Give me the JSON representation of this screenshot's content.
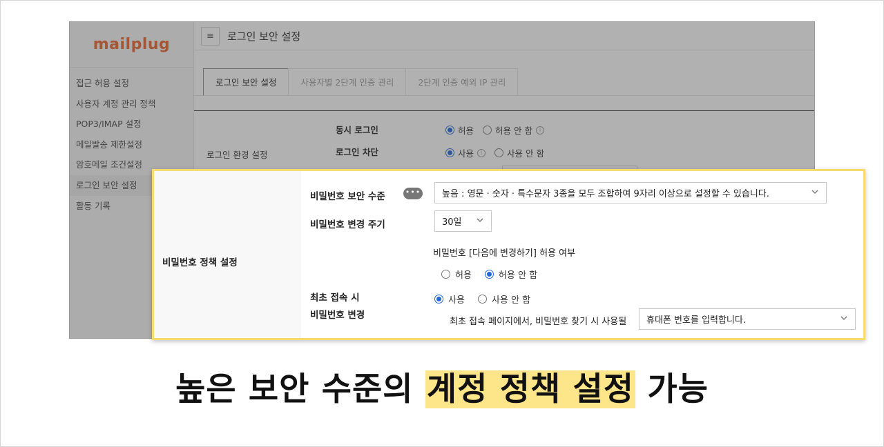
{
  "app": {
    "logo": "mailplug",
    "page_title": "로그인 보안 설정",
    "sidebar": [
      {
        "label": "접근 허용 설정"
      },
      {
        "label": "사용자 계정 관리 정책"
      },
      {
        "label": "POP3/IMAP 설정"
      },
      {
        "label": "메일발송 제한설정"
      },
      {
        "label": "암호메일 조건설정"
      },
      {
        "label": "로그인 보안 설정",
        "active": true
      },
      {
        "label": "활동 기록"
      }
    ],
    "tabs": [
      {
        "label": "로그인 보안 설정",
        "active": true
      },
      {
        "label": "사용자별 2단계 인증 관리"
      },
      {
        "label": "2단계 인증 예외 IP 관리"
      }
    ],
    "login_env": {
      "section_label": "로그인 환경 설정",
      "concurrent_login": {
        "label": "동시 로그인",
        "opt_allow": "허용",
        "opt_deny": "허용 안 함",
        "selected": "허용"
      },
      "login_block": {
        "label": "로그인 차단",
        "opt_use": "사용",
        "opt_nouse": "사용 안 함",
        "selected": "사용"
      }
    }
  },
  "panel": {
    "section_label": "비밀번호 정책 설정",
    "security_level": {
      "label": "비밀번호 보안 수준",
      "dots": "•••",
      "value": "높음 : 영문 · 숫자 · 특수문자 3종을 모두 조합하여 9자리 이상으로 설정할 수 있습니다."
    },
    "change_cycle": {
      "label": "비밀번호 변경 주기",
      "value": "30일",
      "defer_label": "비밀번호 [다음에 변경하기] 허용 여부",
      "opt_allow": "허용",
      "opt_deny": "허용 안 함",
      "selected": "허용 안 함"
    },
    "first_login": {
      "label_line1": "최초 접속 시",
      "label_line2": "비밀번호 변경",
      "opt_use": "사용",
      "opt_nouse": "사용 안 함",
      "selected": "사용",
      "find_label": "최초 접속 페이지에서, 비밀번호 찾기 시 사용될",
      "find_value": "휴대폰 번호를 입력합니다."
    }
  },
  "caption": {
    "prefix": "높은 보안 수준의 ",
    "highlight": "계정 정책 설정",
    "suffix": " 가능"
  },
  "colors": {
    "accent": "#2467d8",
    "highlight": "#fde58a",
    "panel_border": "#f6dc6e",
    "logo": "#e8632b"
  }
}
